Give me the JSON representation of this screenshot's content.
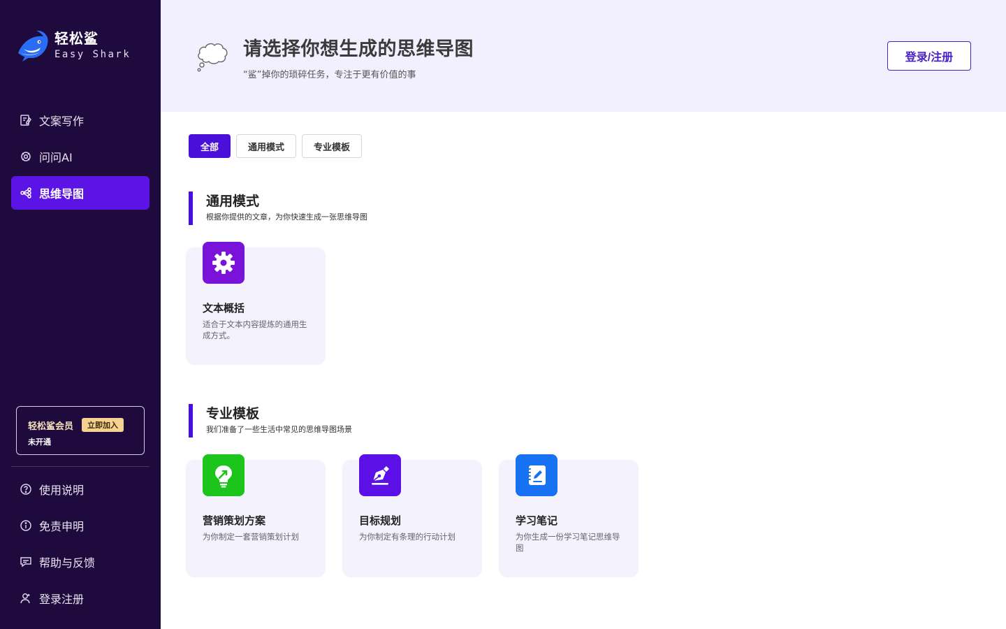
{
  "brand": {
    "name": "轻松鲨",
    "sub": "Easy Shark"
  },
  "nav": [
    {
      "label": "文案写作",
      "icon": "copywriting-icon",
      "active": false
    },
    {
      "label": "问问AI",
      "icon": "ai-chat-icon",
      "active": false
    },
    {
      "label": "思维导图",
      "icon": "mindmap-icon",
      "active": true
    }
  ],
  "member": {
    "title": "轻松鲨会员",
    "join": "立即加入",
    "status": "未开通"
  },
  "bottom_nav": [
    {
      "label": "使用说明",
      "icon": "help-circle-icon"
    },
    {
      "label": "免责申明",
      "icon": "info-circle-icon"
    },
    {
      "label": "帮助与反馈",
      "icon": "feedback-icon"
    },
    {
      "label": "登录注册",
      "icon": "user-icon"
    }
  ],
  "hero": {
    "title": "请选择你想生成的思维导图",
    "subtitle": "“鲨”掉你的琐碎任务，专注于更有价值的事",
    "login": "登录/注册"
  },
  "tabs": [
    {
      "label": "全部",
      "active": true
    },
    {
      "label": "通用模式",
      "active": false
    },
    {
      "label": "专业模板",
      "active": false
    }
  ],
  "sections": [
    {
      "title": "通用模式",
      "desc": "根据你提供的文章，为你快速生成一张思维导图",
      "cards": [
        {
          "title": "文本概括",
          "desc": "适合于文本内容提炼的通用生成方式。",
          "color": "#7a12d9",
          "icon": "gear-icon"
        }
      ]
    },
    {
      "title": "专业模板",
      "desc": "我们准备了一些生活中常见的思维导图场景",
      "cards": [
        {
          "title": "营销策划方案",
          "desc": "为你制定一套营销策划计划",
          "color": "#1cc51c",
          "icon": "lightbulb-icon"
        },
        {
          "title": "目标规划",
          "desc": "为你制定有条理的行动计划",
          "color": "#5a10e6",
          "icon": "pen-nib-icon"
        },
        {
          "title": "学习笔记",
          "desc": "为你生成一份学习笔记思维导图",
          "color": "#1672f2",
          "icon": "notebook-icon"
        }
      ]
    }
  ]
}
